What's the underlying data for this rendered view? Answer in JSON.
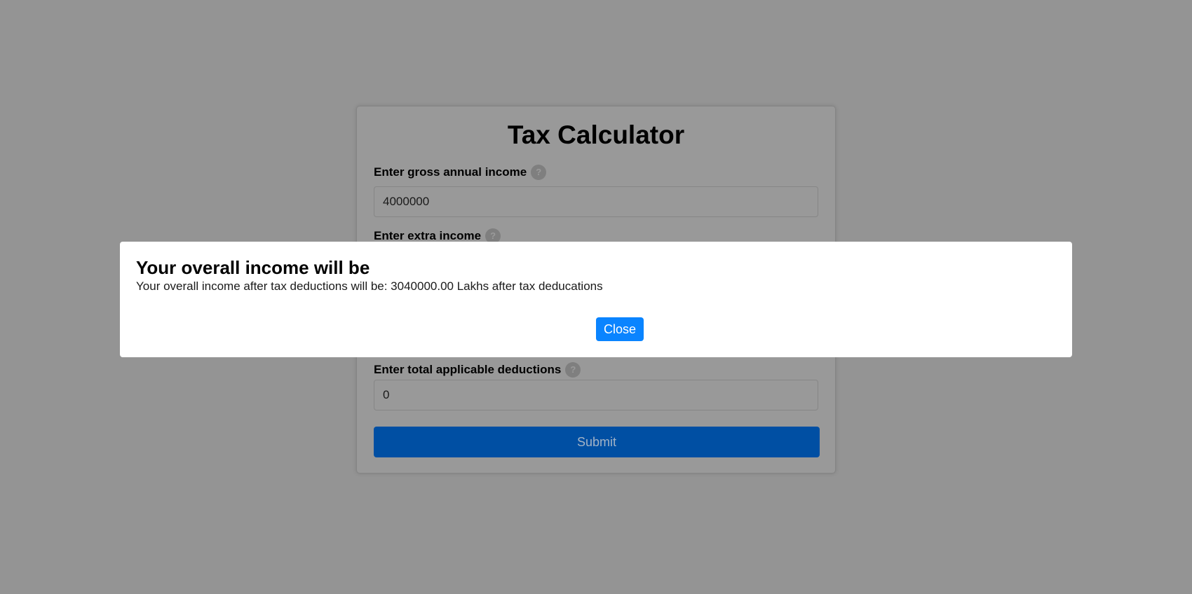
{
  "form": {
    "title": "Tax Calculator",
    "fields": [
      {
        "label": "Enter gross annual income",
        "value": "4000000"
      },
      {
        "label": "Enter extra income"
      },
      {
        "label": "Enter total applicable deductions",
        "value": "0"
      }
    ],
    "help_glyph": "?",
    "submit_label": "Submit"
  },
  "modal": {
    "title": "Your overall income will be",
    "message": "Your overall income after tax deductions will be: 3040000.00 Lakhs after tax deducations",
    "close_label": "Close"
  },
  "colors": {
    "submit": "#004fa3",
    "close": "#0a84ff",
    "overlay": "#949494"
  }
}
